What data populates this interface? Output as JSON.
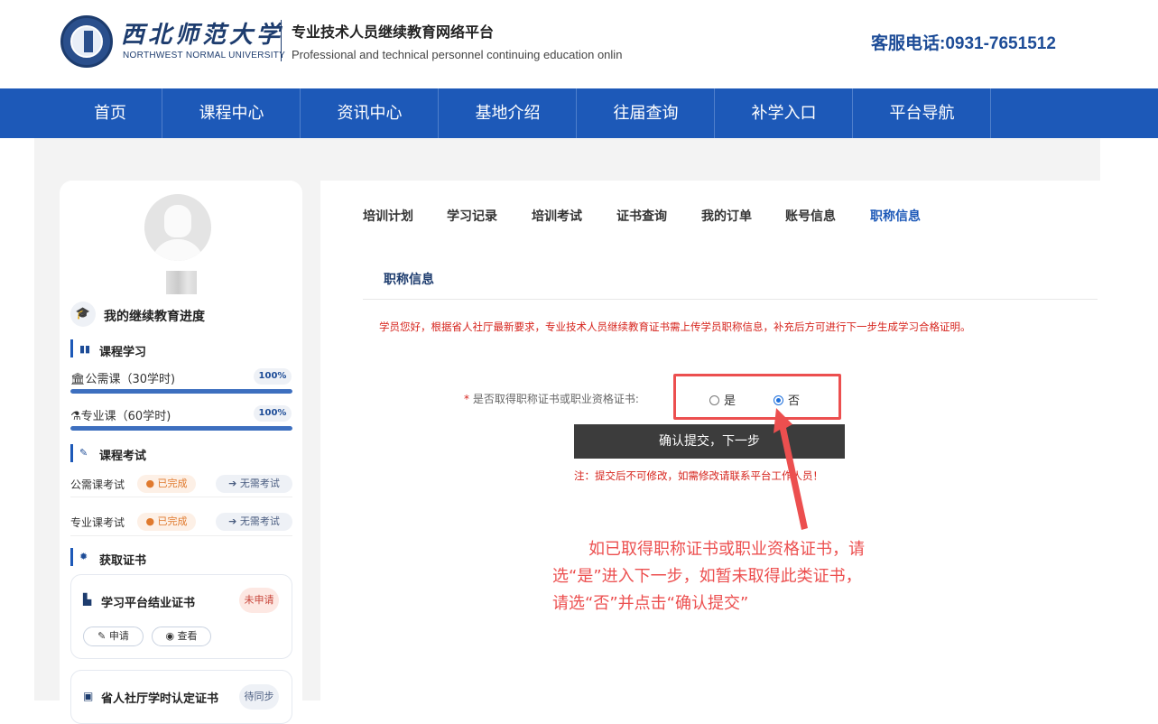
{
  "header": {
    "logo_cn": "西北师范大学",
    "logo_en": "NORTHWEST NORMAL UNIVERSITY",
    "platform_title": "专业技术人员继续教育网络平台",
    "platform_subtitle": "Professional and technical personnel continuing education onlin",
    "hotline": "客服电话:0931-7651512"
  },
  "nav": {
    "items": [
      {
        "label": "首页"
      },
      {
        "label": "课程中心"
      },
      {
        "label": "资讯中心"
      },
      {
        "label": "基地介绍"
      },
      {
        "label": "往届查询"
      },
      {
        "label": "补学入口"
      },
      {
        "label": "平台导航"
      }
    ]
  },
  "sidebar": {
    "progress_heading": "我的继续教育进度",
    "course_section": "课程学习",
    "courses": [
      {
        "label": "公需课（30学时)",
        "percent_label": "100%",
        "progress": 1.0
      },
      {
        "label": "专业课（60学时)",
        "percent_label": "100%",
        "progress": 1.0
      }
    ],
    "exam_section": "课程考试",
    "exams": [
      {
        "label": "公需课考试",
        "status": "已完成",
        "action": "无需考试"
      },
      {
        "label": "专业课考试",
        "status": "已完成",
        "action": "无需考试"
      }
    ],
    "cert_section": "获取证书",
    "certs": [
      {
        "title": "学习平台结业证书",
        "status": "未申请",
        "apply_label": "申请",
        "view_label": "查看"
      },
      {
        "title": "省人社厅学时认定证书",
        "status": "待同步"
      }
    ]
  },
  "tabs": [
    {
      "label": "培训计划"
    },
    {
      "label": "学习记录"
    },
    {
      "label": "培训考试"
    },
    {
      "label": "证书查询"
    },
    {
      "label": "我的订单"
    },
    {
      "label": "账号信息"
    },
    {
      "label": "职称信息"
    }
  ],
  "active_tab": "职称信息",
  "main": {
    "section_title": "职称信息",
    "notice": "学员您好，根据省人社厅最新要求，专业技术人员继续教育证书需上传学员职称信息，补充后方可进行下一步生成学习合格证明。",
    "question_required_mark": "*",
    "question_label": "是否取得职称证书或职业资格证书:",
    "options": [
      {
        "label": "是",
        "checked": false
      },
      {
        "label": "否",
        "checked": true
      }
    ],
    "submit_label": "确认提交，下一步",
    "note": "注：提交后不可修改，如需修改请联系平台工作人员！",
    "annotation_lines": [
      "如已取得职称证书或职业资格证书，请",
      "选“是”进入下一步，如暂未取得此类证书，",
      "请选“否”并点击“确认提交”"
    ]
  },
  "colors": {
    "brand_blue": "#1d59b8",
    "annotation_red": "#ec4f4f",
    "notice_red": "#d6241d",
    "submit_dark": "#3c3c3c"
  }
}
